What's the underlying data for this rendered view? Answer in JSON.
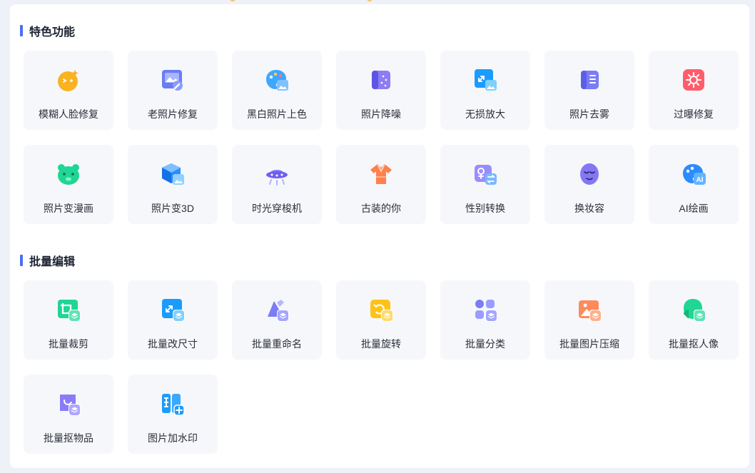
{
  "colors": {
    "accent": "#4c6ef5",
    "card_bg": "#f6f7fa",
    "panel_bg": "#ffffff",
    "page_bg": "#eef1f8"
  },
  "sections": [
    {
      "title": "特色功能",
      "items": [
        {
          "label": "模糊人脸修复",
          "icon": "blur-face-repair-icon"
        },
        {
          "label": "老照片修复",
          "icon": "old-photo-repair-icon"
        },
        {
          "label": "黑白照片上色",
          "icon": "colorize-palette-icon"
        },
        {
          "label": "照片降噪",
          "icon": "denoise-icon"
        },
        {
          "label": "无损放大",
          "icon": "lossless-upscale-icon"
        },
        {
          "label": "照片去雾",
          "icon": "dehaze-icon"
        },
        {
          "label": "过曝修复",
          "icon": "overexposure-sun-icon"
        },
        {
          "label": "照片变漫画",
          "icon": "cartoon-bear-icon"
        },
        {
          "label": "照片变3D",
          "icon": "photo-3d-cube-icon"
        },
        {
          "label": "时光穿梭机",
          "icon": "time-machine-ufo-icon"
        },
        {
          "label": "古装的你",
          "icon": "ancient-costume-icon"
        },
        {
          "label": "性别转换",
          "icon": "gender-swap-icon"
        },
        {
          "label": "换妆容",
          "icon": "makeup-face-icon"
        },
        {
          "label": "AI绘画",
          "icon": "ai-painting-icon"
        }
      ]
    },
    {
      "title": "批量编辑",
      "items": [
        {
          "label": "批量裁剪",
          "icon": "batch-crop-icon"
        },
        {
          "label": "批量改尺寸",
          "icon": "batch-resize-icon"
        },
        {
          "label": "批量重命名",
          "icon": "batch-rename-icon"
        },
        {
          "label": "批量旋转",
          "icon": "batch-rotate-icon"
        },
        {
          "label": "批量分类",
          "icon": "batch-classify-icon"
        },
        {
          "label": "批量图片压缩",
          "icon": "batch-compress-icon"
        },
        {
          "label": "批量抠人像",
          "icon": "batch-portrait-cutout-icon"
        },
        {
          "label": "批量抠物品",
          "icon": "batch-object-cutout-icon"
        },
        {
          "label": "图片加水印",
          "icon": "add-watermark-icon"
        }
      ]
    }
  ]
}
